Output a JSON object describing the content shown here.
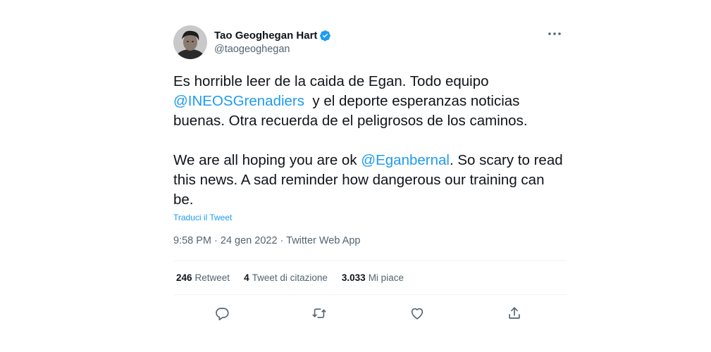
{
  "author": {
    "display_name": "Tao Geoghegan Hart",
    "handle": "@taogeoghegan",
    "verified_icon": "verified-badge-icon",
    "avatar_icon": "avatar-photo"
  },
  "tweet": {
    "p1_a": "Es horrible leer de la caida de Egan. Todo equipo ",
    "p1_mention": "@INEOSGrenadiers",
    "p1_b": "  y el deporte esperanzas noticias buenas. Otra recuerda de el peligrosos de los caminos.",
    "p2_a": "We are all hoping you are ok ",
    "p2_mention": "@Eganbernal",
    "p2_b": ". So scary to read this news. A sad reminder how dangerous our training can be."
  },
  "translate_label": "Traduci il Tweet",
  "meta": {
    "time": "9:58 PM",
    "separator": " · ",
    "date": "24 gen 2022",
    "source": "Twitter Web App"
  },
  "stats": {
    "retweets_count": "246",
    "retweets_label": "Retweet",
    "quotes_count": "4",
    "quotes_label": "Tweet di citazione",
    "likes_count": "3.033",
    "likes_label": "Mi piace"
  },
  "actions": [
    "reply-icon",
    "retweet-icon",
    "like-icon",
    "share-icon"
  ],
  "colors": {
    "accent": "#1d9bf0",
    "text": "#0f1419",
    "secondary": "#536471",
    "divider": "#eff3f4"
  }
}
